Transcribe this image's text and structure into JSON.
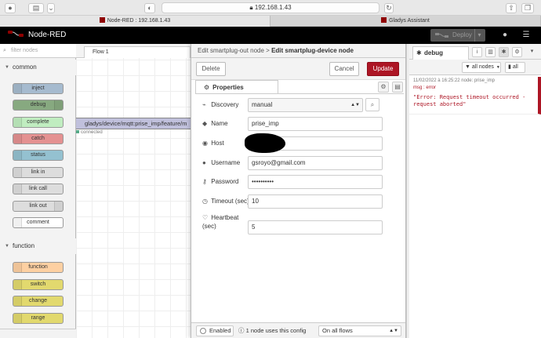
{
  "browser": {
    "url": "192.168.1.43",
    "tabs": [
      {
        "title": "Node-RED : 192.168.1.43"
      },
      {
        "title": "Gladys Assistant"
      }
    ]
  },
  "header": {
    "app_name": "Node-RED",
    "deploy_label": "Deploy"
  },
  "palette": {
    "filter_placeholder": "filter nodes",
    "categories": [
      {
        "label": "common",
        "nodes": [
          {
            "label": "inject",
            "color": "#a6bbcf"
          },
          {
            "label": "debug",
            "color": "#87a980"
          },
          {
            "label": "complete",
            "color": "#c0edc0"
          },
          {
            "label": "catch",
            "color": "#e49191"
          },
          {
            "label": "status",
            "color": "#94c1d0"
          },
          {
            "label": "link in",
            "color": "#dddddd"
          },
          {
            "label": "link call",
            "color": "#dddddd"
          },
          {
            "label": "link out",
            "color": "#dddddd"
          },
          {
            "label": "comment",
            "color": "#ffffff"
          }
        ]
      },
      {
        "label": "function",
        "nodes": [
          {
            "label": "function",
            "color": "#fdd0a2"
          },
          {
            "label": "switch",
            "color": "#e2d96e"
          },
          {
            "label": "change",
            "color": "#e2d96e"
          },
          {
            "label": "range",
            "color": "#e2d96e"
          }
        ]
      }
    ]
  },
  "workspace": {
    "flow_tab": "Flow 1",
    "node_label": "gladys/device/mqtt:prise_imp/feature/m",
    "node_status": "connected"
  },
  "tray": {
    "breadcrumb_parent": "Edit smartplug-out node",
    "breadcrumb_sep": ">",
    "breadcrumb_current": "Edit smartplug-device node",
    "delete_label": "Delete",
    "cancel_label": "Cancel",
    "update_label": "Update",
    "properties_tab": "Properties",
    "fields": {
      "discovery": {
        "label": "Discovery",
        "value": "manual"
      },
      "name": {
        "label": "Name",
        "value": "prise_imp"
      },
      "host": {
        "label": "Host",
        "value": ""
      },
      "username": {
        "label": "Username",
        "value": "gsroyo@gmail.com"
      },
      "password": {
        "label": "Password",
        "value": "••••••••••"
      },
      "timeout": {
        "label": "Timeout (sec)",
        "value": "10"
      },
      "heartbeat": {
        "label": "Heartbeat (sec)",
        "label_line1": "Heartbeat",
        "label_line2": "(sec)",
        "value": "5"
      }
    },
    "footer": {
      "enabled_label": "Enabled",
      "usage_info": "1 node uses this config",
      "scope_value": "On all flows"
    }
  },
  "sidebar": {
    "tab_label": "debug",
    "filter_label": "all nodes",
    "clear_label": "all",
    "messages": [
      {
        "meta": "11/02/2022 à 16:25:22   node: prise_imp",
        "type": "msg : error",
        "text": "\"Error: Request timeout occurred - request aborted\""
      }
    ]
  }
}
